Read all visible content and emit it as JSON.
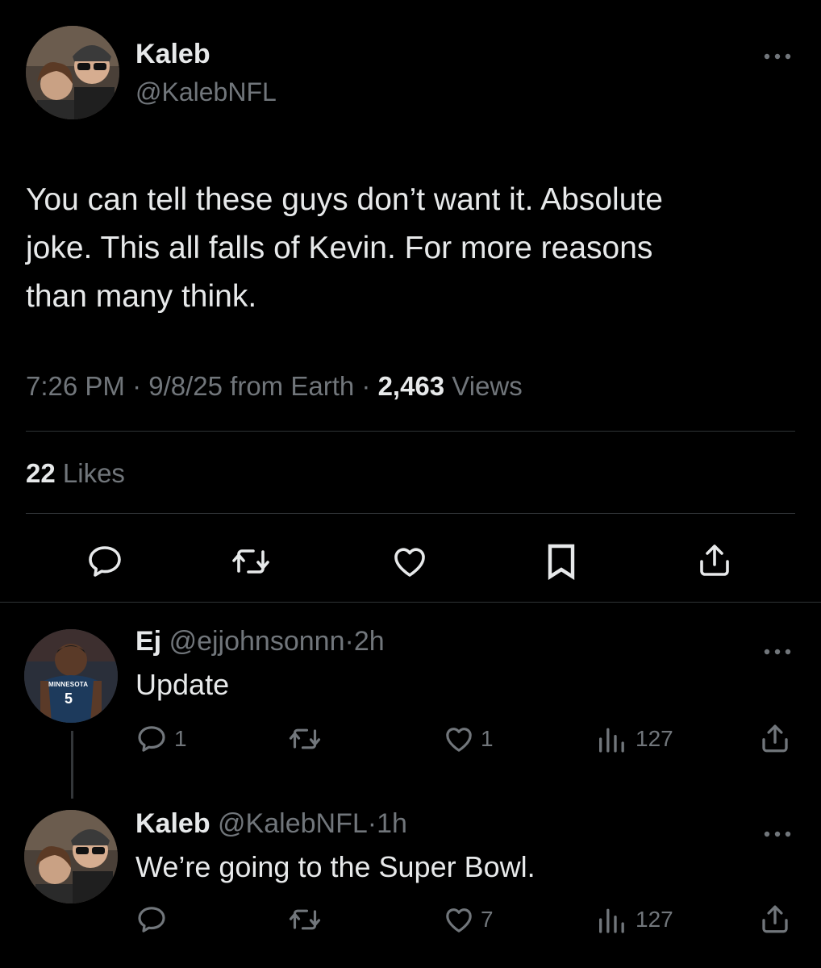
{
  "main_tweet": {
    "name": "Kaleb",
    "handle": "@KalebNFL",
    "text_lines": [
      "You can tell these guys don’t want it. Absolute",
      "joke. This all falls of Kevin. For more reasons",
      "than many think."
    ],
    "time": "7:26 PM",
    "date": "9/8/25",
    "location": "from Earth",
    "views_count": "2,463",
    "views_label": "Views",
    "likes_count": "22",
    "likes_label": "Likes"
  },
  "sep": "·",
  "replies": [
    {
      "name": "Ej",
      "handle": "@ejjohnsonnn",
      "age": "2h",
      "text": "Update",
      "reply_count": "1",
      "retweet_count": "",
      "like_count": "1",
      "views": "127",
      "jersey_text": "MINNESOTA",
      "jersey_number": "5"
    },
    {
      "name": "Kaleb",
      "handle": "@KalebNFL",
      "age": "1h",
      "text": "We’re going to the Super Bowl.",
      "reply_count": "",
      "retweet_count": "",
      "like_count": "7",
      "views": "127"
    }
  ],
  "icons": {
    "more": "more-icon",
    "reply": "reply-icon",
    "retweet": "retweet-icon",
    "like": "heart-icon",
    "bookmark": "bookmark-icon",
    "share": "share-icon",
    "views": "views-icon"
  },
  "colors": {
    "background": "#000000",
    "text": "#e7e9ea",
    "muted": "#71767b",
    "divider": "#2f3336"
  }
}
